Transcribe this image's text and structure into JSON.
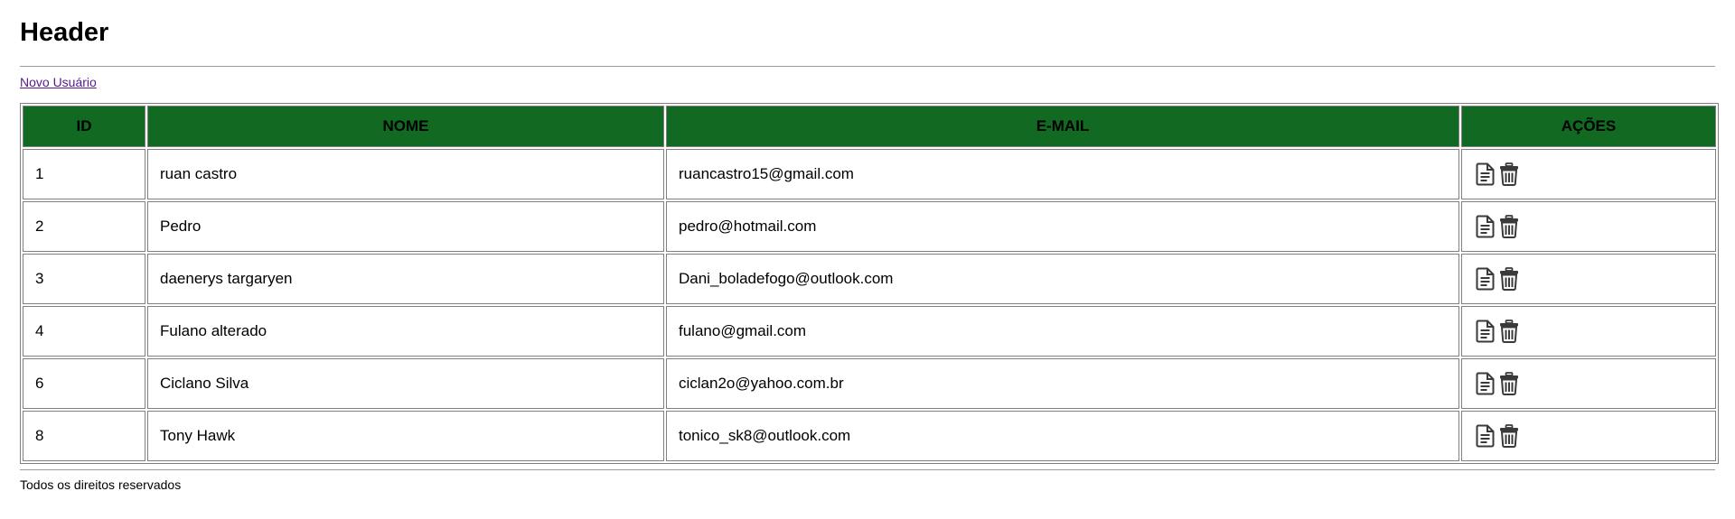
{
  "header": {
    "title": "Header"
  },
  "nav": {
    "new_user_label": "Novo Usuário"
  },
  "table": {
    "columns": [
      "ID",
      "NOME",
      "E-MAIL",
      "AÇÕES"
    ],
    "rows": [
      {
        "id": "1",
        "name": "ruan castro",
        "email": "ruancastro15@gmail.com"
      },
      {
        "id": "2",
        "name": "Pedro",
        "email": "pedro@hotmail.com"
      },
      {
        "id": "3",
        "name": "daenerys targaryen",
        "email": "Dani_boladefogo@outlook.com"
      },
      {
        "id": "4",
        "name": "Fulano alterado",
        "email": "fulano@gmail.com"
      },
      {
        "id": "6",
        "name": "Ciclano Silva",
        "email": "ciclan2o@yahoo.com.br"
      },
      {
        "id": "8",
        "name": "Tony Hawk",
        "email": "tonico_sk8@outlook.com"
      }
    ],
    "row_actions": [
      "document-icon",
      "trash-icon"
    ]
  },
  "footer": {
    "text": "Todos os direitos reservados"
  },
  "colors": {
    "header_row_bg": "#116922",
    "link": "#551a8b",
    "border": "#808080"
  }
}
